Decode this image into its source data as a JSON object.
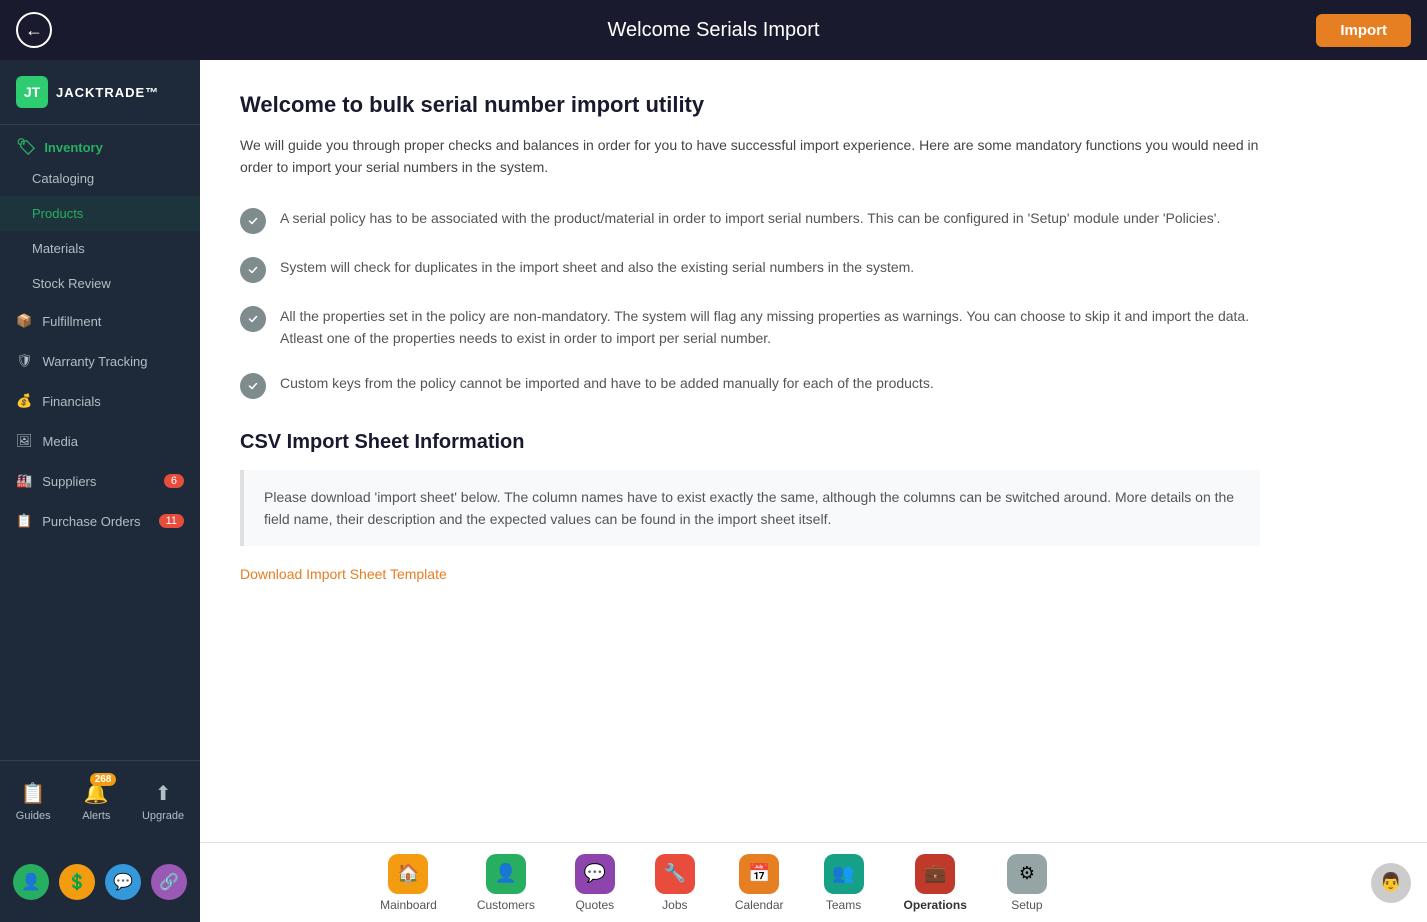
{
  "header": {
    "title": "Welcome Serials Import",
    "back_label": "←",
    "import_label": "Import"
  },
  "sidebar": {
    "logo_text": "JACKTRADE™",
    "sections": [
      {
        "id": "inventory",
        "label": "Inventory",
        "active": true,
        "subitems": [
          {
            "id": "cataloging",
            "label": "Cataloging",
            "active": false
          },
          {
            "id": "products",
            "label": "Products",
            "active": true
          },
          {
            "id": "materials",
            "label": "Materials",
            "active": false
          },
          {
            "id": "stock-review",
            "label": "Stock Review",
            "active": false
          }
        ]
      },
      {
        "id": "fulfillment",
        "label": "Fulfillment",
        "active": false,
        "subitems": []
      },
      {
        "id": "warranty-tracking",
        "label": "Warranty Tracking",
        "active": false,
        "subitems": []
      },
      {
        "id": "financials",
        "label": "Financials",
        "active": false,
        "subitems": []
      },
      {
        "id": "media",
        "label": "Media",
        "active": false,
        "subitems": []
      },
      {
        "id": "suppliers",
        "label": "Suppliers",
        "badge": "6",
        "active": false,
        "subitems": []
      },
      {
        "id": "purchase-orders",
        "label": "Purchase Orders",
        "badge": "11",
        "active": false,
        "subitems": []
      }
    ],
    "bottom_items": [
      {
        "id": "guides",
        "label": "Guides",
        "icon": "📋"
      },
      {
        "id": "alerts",
        "label": "Alerts",
        "icon": "🔔",
        "badge": "268"
      },
      {
        "id": "upgrade",
        "label": "Upgrade",
        "icon": "⬆"
      }
    ],
    "bottom_user_icons": [
      {
        "id": "user",
        "color": "#2ecc71"
      },
      {
        "id": "dollar",
        "color": "#f39c12"
      },
      {
        "id": "chat",
        "color": "#3498db"
      },
      {
        "id": "share",
        "color": "#9b59b6"
      }
    ]
  },
  "content": {
    "welcome_heading": "Welcome to bulk serial number import utility",
    "welcome_desc": "We will guide you through proper checks and balances in order for you to have successful import experience. Here are some mandatory functions you would need in order to import your serial numbers in the system.",
    "checklist": [
      {
        "id": "check1",
        "text": "A serial policy has to be associated with the product/material in order to import serial numbers. This can be configured in 'Setup' module under 'Policies'."
      },
      {
        "id": "check2",
        "text": "System will check for duplicates in the import sheet and also the existing serial numbers in the system."
      },
      {
        "id": "check3",
        "text": "All the properties set in the policy are non-mandatory. The system will flag any missing properties as warnings. You can choose to skip it and import the data. Atleast one of the properties needs to exist in order to import per serial number."
      },
      {
        "id": "check4",
        "text": "Custom keys from the policy cannot be imported and have to be added manually for each of the products."
      }
    ],
    "csv_heading": "CSV Import Sheet Information",
    "csv_desc": "Please download 'import sheet' below. The column names have to exist exactly the same, although the columns can be switched around. More details on the field name, their description and the expected values can be found in the import sheet itself.",
    "download_link": "Download Import Sheet Template"
  },
  "bottom_nav": {
    "items": [
      {
        "id": "mainboard",
        "label": "Mainboard",
        "icon": "🏠",
        "color": "#f39c12"
      },
      {
        "id": "customers",
        "label": "Customers",
        "icon": "👤",
        "color": "#27ae60"
      },
      {
        "id": "quotes",
        "label": "Quotes",
        "icon": "💬",
        "color": "#8e44ad"
      },
      {
        "id": "jobs",
        "label": "Jobs",
        "icon": "🔧",
        "color": "#e74c3c"
      },
      {
        "id": "calendar",
        "label": "Calendar",
        "icon": "📅",
        "color": "#f39c12"
      },
      {
        "id": "teams",
        "label": "Teams",
        "icon": "👥",
        "color": "#16a085"
      },
      {
        "id": "operations",
        "label": "Operations",
        "icon": "💼",
        "color": "#c0392b",
        "active": true
      },
      {
        "id": "setup",
        "label": "Setup",
        "icon": "⚙",
        "color": "#7f8c8d"
      }
    ]
  },
  "nav_colors": {
    "mainboard": "#f39c12",
    "customers": "#27ae60",
    "quotes": "#8e44ad",
    "jobs": "#e74c3c",
    "calendar": "#e67e22",
    "teams": "#16a085",
    "operations": "#c0392b",
    "setup": "#95a5a6"
  }
}
